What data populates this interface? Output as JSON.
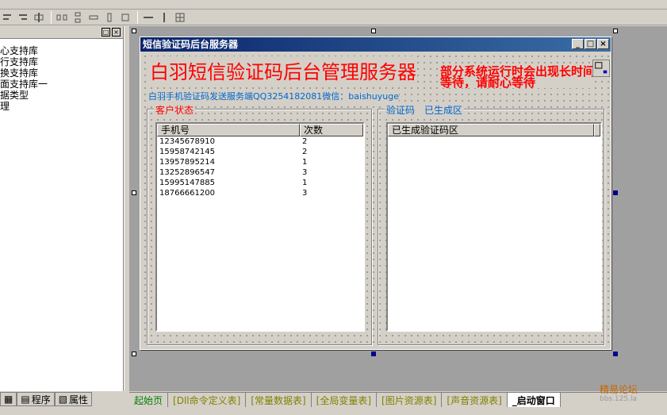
{
  "left_panel": {
    "tree_items": [
      "心支持库",
      "行支持库",
      "换支持库",
      "面支持库一",
      "据类型",
      "理"
    ],
    "tabs": [
      "程序",
      "属性"
    ]
  },
  "form": {
    "window_title": "短信验证码后台服务器",
    "heading": "白羽短信验证码后台管理服务器",
    "warning": "部分系统运行时会出现长时间等待，请耐心等待",
    "subline": "白羽手机验证码发送服务端QQ3254182081微信：baishuyuge",
    "group_client": {
      "label": "客户状态",
      "columns": [
        "手机号",
        "次数"
      ],
      "rows": [
        [
          "12345678910",
          "2"
        ],
        [
          "15958742145",
          "2"
        ],
        [
          "13957895214",
          "1"
        ],
        [
          "13252896547",
          "3"
        ],
        [
          "15995147885",
          "1"
        ],
        [
          "18766661200",
          "3"
        ]
      ]
    },
    "group_codes": {
      "label": "验证码　已生成区",
      "columns": [
        "已生成验证码区"
      ]
    }
  },
  "bottom_tabs": [
    "起始页",
    "[Dll命令定义表]",
    "[常量数据表]",
    "[全局变量表]",
    "[图片资源表]",
    "[声音资源表]",
    "_启动窗口"
  ],
  "watermark": {
    "line1": "精易论坛",
    "line2": "bbs.125.la"
  }
}
